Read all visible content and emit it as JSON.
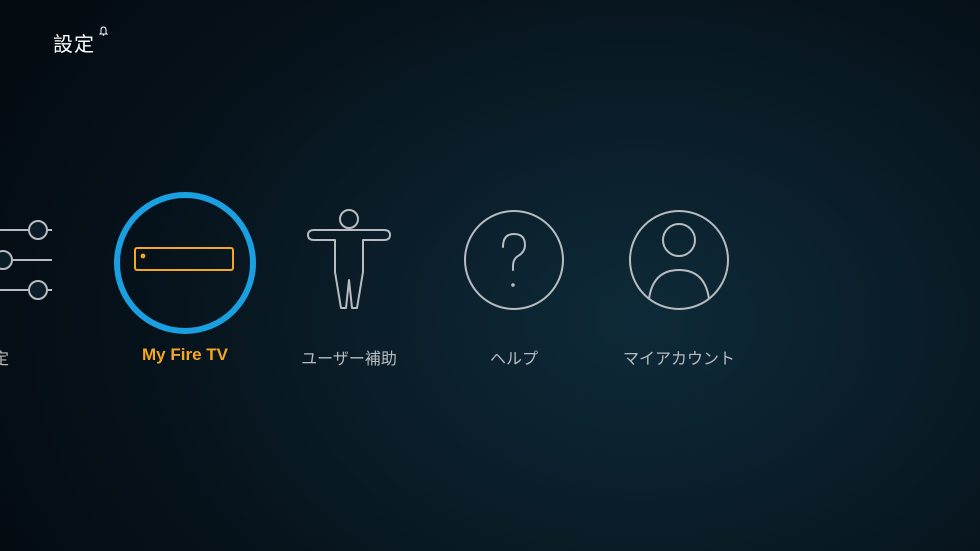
{
  "header": {
    "title": "設定",
    "notification_icon": "bell-icon"
  },
  "menu": {
    "items": [
      {
        "label": "環境設定",
        "icon": "sliders-icon",
        "selected": false
      },
      {
        "label": "My Fire TV",
        "icon": "fire-tv-device-icon",
        "selected": true
      },
      {
        "label": "ユーザー補助",
        "icon": "accessibility-person-icon",
        "selected": false
      },
      {
        "label": "ヘルプ",
        "icon": "help-question-icon",
        "selected": false
      },
      {
        "label": "マイアカウント",
        "icon": "account-person-icon",
        "selected": false
      }
    ]
  },
  "colors": {
    "background": "#0a1d28",
    "selection_ring": "#1a9fe0",
    "selected_label": "#f5a623",
    "icon_stroke": "#b8bcc0",
    "title": "#ffffff"
  }
}
